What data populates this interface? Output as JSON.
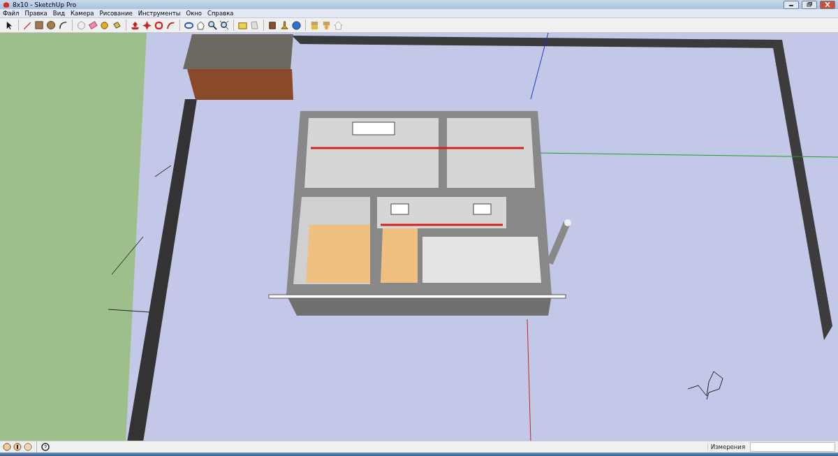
{
  "window": {
    "title": "8x10 - SketchUp Pro"
  },
  "menu": [
    "Файл",
    "Правка",
    "Вид",
    "Камера",
    "Рисование",
    "Инструменты",
    "Окно",
    "Справка"
  ],
  "status_bar": {
    "measurements_label": "Измерения"
  }
}
